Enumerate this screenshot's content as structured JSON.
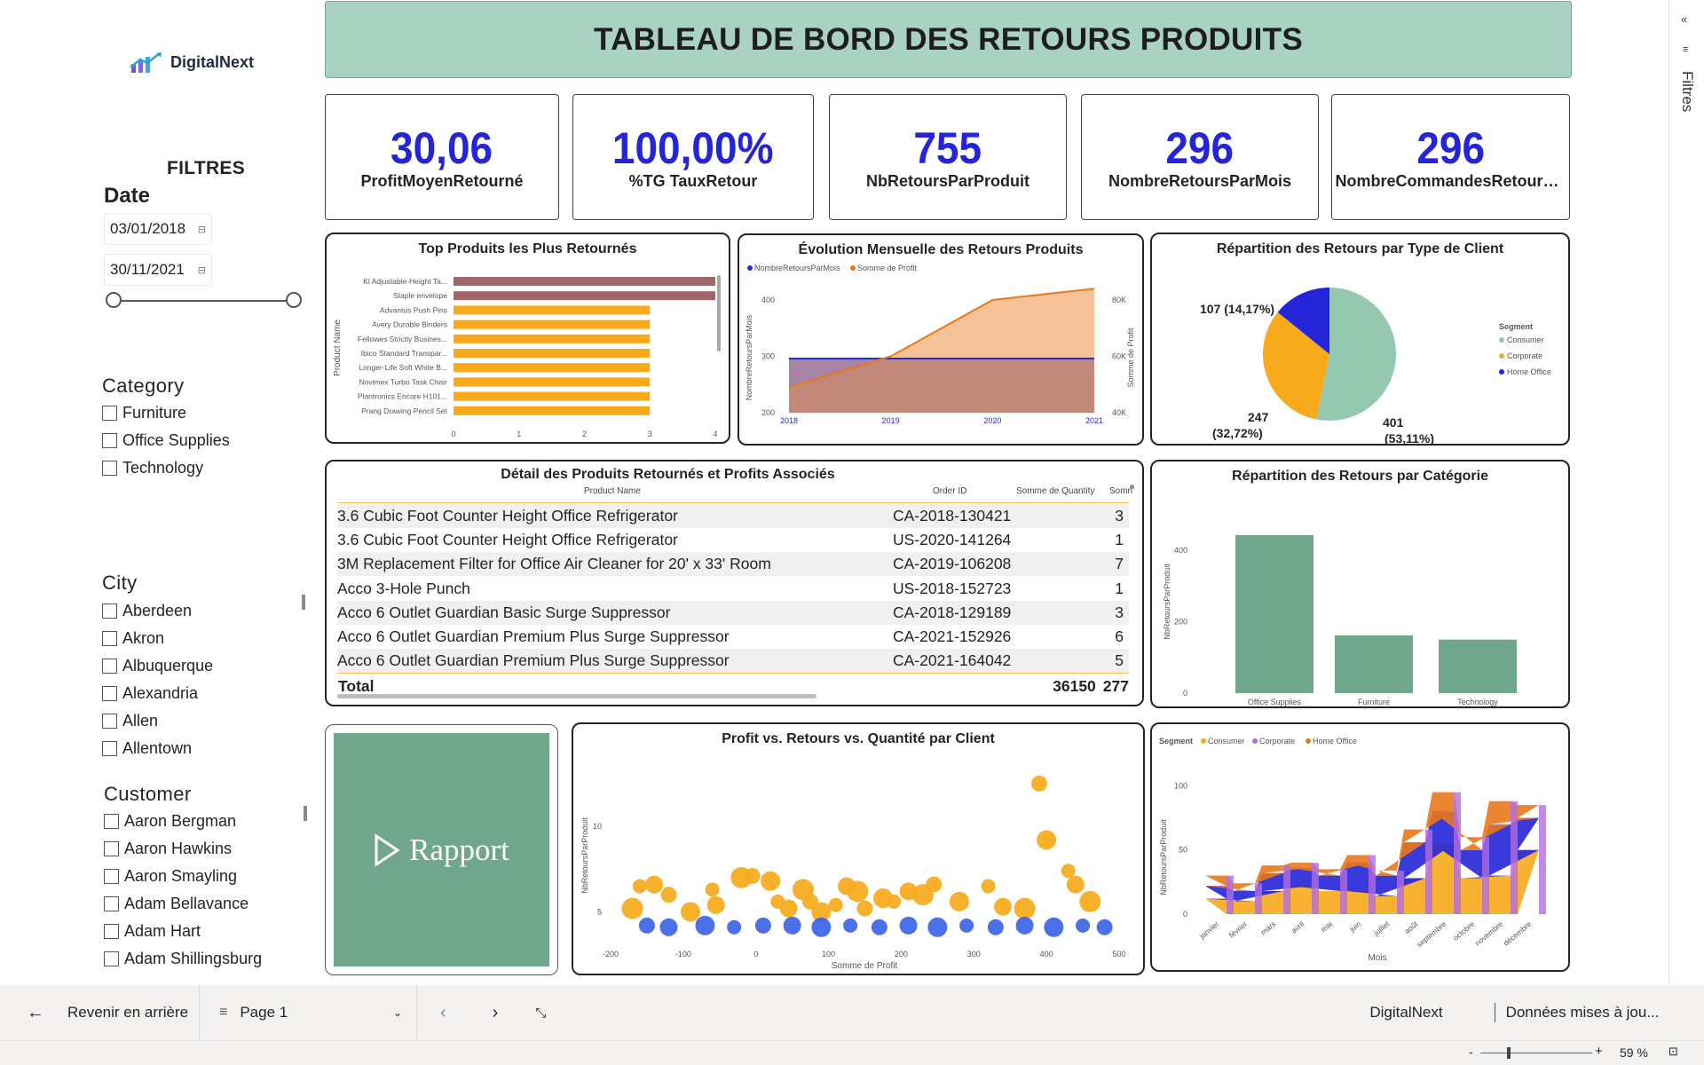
{
  "brand": {
    "name": "DigitalNext"
  },
  "sidebar": {
    "filters_title": "FILTRES",
    "date": {
      "title": "Date",
      "start": "03/01/2018",
      "end": "30/11/2021",
      "calendar_icon": "calendar-icon"
    },
    "category": {
      "title": "Category",
      "items": [
        "Furniture",
        "Office Supplies",
        "Technology"
      ]
    },
    "city": {
      "title": "City",
      "items": [
        "Aberdeen",
        "Akron",
        "Albuquerque",
        "Alexandria",
        "Allen",
        "Allentown"
      ]
    },
    "customer": {
      "title": "Customer",
      "items": [
        "Aaron Bergman",
        "Aaron Hawkins",
        "Aaron Smayling",
        "Adam Bellavance",
        "Adam Hart",
        "Adam Shillingsburg"
      ]
    }
  },
  "header": {
    "title": "TABLEAU DE BORD DES RETOURS PRODUITS"
  },
  "kpis": [
    {
      "value": "30,06",
      "label": "ProfitMoyenRetourné"
    },
    {
      "value": "100,00%",
      "label": "%TG TauxRetour"
    },
    {
      "value": "755",
      "label": "NbRetoursParProduit"
    },
    {
      "value": "296",
      "label": "NombreRetoursParMois"
    },
    {
      "value": "296",
      "label": "NombreCommandesRetourn..."
    }
  ],
  "top_products": {
    "title": "Top Produits les Plus Retournés",
    "ylabel": "Product Name",
    "x_ticks": [
      "0",
      "1",
      "2",
      "3",
      "4"
    ],
    "colors": {
      "top": "#a0666a",
      "rest": "#f7aa1b"
    }
  },
  "monthly": {
    "title": "Évolution Mensuelle des Retours Produits",
    "legend": [
      "NombreRetoursParMois",
      "Somme de Profit"
    ],
    "ylabel_left": "NombreRetoursParMois",
    "ylabel_right": "Somme de Profit",
    "left_ticks": [
      "400",
      "300",
      "200"
    ],
    "right_ticks": [
      "80K",
      "60K",
      "40K"
    ],
    "x_ticks": [
      "2018",
      "2019",
      "2020",
      "2021"
    ],
    "colors": {
      "returns": "#2b2bd6",
      "profit": "#e9781b"
    }
  },
  "segment_pie": {
    "title": "Répartition des Retours par Type de Client",
    "legend_title": "Segment",
    "labels": {
      "office": "107 (14,17%)",
      "corporate_count": "247",
      "corporate_pct": "(32,72%)",
      "consumer_count": "401",
      "consumer_pct": "(53,11%)"
    },
    "colors": {
      "consumer": "#95c7b1",
      "corporate": "#f7aa1b",
      "office": "#2424d8"
    }
  },
  "detail_table": {
    "title": "Détail des Produits Retournés et Profits Associés",
    "columns": [
      "Product Name",
      "Order ID",
      "Somme de Quantity",
      "Somn"
    ],
    "rows": [
      {
        "product": "3.6 Cubic Foot Counter Height Office Refrigerator",
        "order": "CA-2018-130421",
        "qty": "3"
      },
      {
        "product": "3.6 Cubic Foot Counter Height Office Refrigerator",
        "order": "US-2020-141264",
        "qty": "1"
      },
      {
        "product": "3M Replacement Filter for Office Air Cleaner for 20' x 33' Room",
        "order": "CA-2019-106208",
        "qty": "7"
      },
      {
        "product": "Acco 3-Hole Punch",
        "order": "US-2018-152723",
        "qty": "1"
      },
      {
        "product": "Acco 6 Outlet Guardian Basic Surge Suppressor",
        "order": "CA-2018-129189",
        "qty": "3"
      },
      {
        "product": "Acco 6 Outlet Guardian Premium Plus Surge Suppressor",
        "order": "CA-2021-152926",
        "qty": "6"
      },
      {
        "product": "Acco 6 Outlet Guardian Premium Plus Surge Suppressor",
        "order": "CA-2021-164042",
        "qty": "5"
      }
    ],
    "total_label": "Total",
    "total_qty": "36150",
    "total_extra": "277"
  },
  "category_chart": {
    "title": "Répartition des Retours par Catégorie",
    "xlabel": "Category",
    "ylabel": "NbRetoursParProduit",
    "y_ticks": [
      "400",
      "200",
      "0"
    ],
    "color": "#6fa68c"
  },
  "report_button": {
    "label": "Rapport",
    "color": "#6fa68c"
  },
  "scatter": {
    "title": "Profit vs. Retours vs. Quantité par Client",
    "xlabel": "Somme de Profit",
    "ylabel": "NbRetoursParProduit",
    "x_ticks": [
      "-200",
      "-100",
      "0",
      "100",
      "200",
      "300",
      "400",
      "500"
    ],
    "y_ticks": [
      "10",
      "5"
    ],
    "colors": {
      "high": "#f7aa1b",
      "low": "#3c64e6"
    }
  },
  "ribbon": {
    "legend_title": "Segment",
    "legend": [
      "Consumer",
      "Corporate",
      "Home Office"
    ],
    "xlabel": "Mois",
    "ylabel": "NbRetoursParProduit",
    "y_ticks": [
      "100",
      "50",
      "0"
    ],
    "months": [
      "janvier",
      "février",
      "mars",
      "avril",
      "mai",
      "juin",
      "juillet",
      "août",
      "septembre",
      "octobre",
      "novembre",
      "décembre"
    ],
    "colors": {
      "consumer": "#f7aa1b",
      "corporate": "#b36be0",
      "office": "#e9781b"
    }
  },
  "bottom_bar": {
    "back": "Revenir en arrière",
    "page": "Page 1",
    "brand": "DigitalNext",
    "updated": "Données mises à jou..."
  },
  "status_bar": {
    "zoom": "59 %"
  },
  "right_rail": {
    "label": "Filtres"
  },
  "chart_data": [
    {
      "type": "bar",
      "title": "Top Produits les Plus Retournés",
      "orientation": "horizontal",
      "categories": [
        "Kl Adjustable-Height Ta...",
        "Staple envelope",
        "Advantus Push Pins",
        "Avery Durable Binders",
        "Fellowes Strictly Busines...",
        "Ibico Standard Transpar...",
        "Longer-Life Soft White B...",
        "Novimex Turbo Task Chair",
        "Plantronics Encore H101...",
        "Prang Drawing Pencil Set"
      ],
      "values": [
        4,
        4,
        3,
        3,
        3,
        3,
        3,
        3,
        3,
        3
      ],
      "ylabel": "Product Name",
      "xlim": [
        0,
        4
      ]
    },
    {
      "type": "area",
      "title": "Évolution Mensuelle des Retours Produits",
      "x": [
        "2018",
        "2019",
        "2020",
        "2021"
      ],
      "series": [
        {
          "name": "NombreRetoursParMois",
          "values": [
            296,
            296,
            296,
            296
          ],
          "axis": "left"
        },
        {
          "name": "Somme de Profit",
          "values": [
            49000,
            60000,
            80000,
            84000
          ],
          "axis": "right"
        }
      ],
      "ylim_left": [
        200,
        400
      ],
      "ylim_right": [
        40000,
        80000
      ]
    },
    {
      "type": "pie",
      "title": "Répartition des Retours par Type de Client",
      "categories": [
        "Consumer",
        "Corporate",
        "Home Office"
      ],
      "values": [
        401,
        247,
        107
      ],
      "percent": [
        53.11,
        32.72,
        14.17
      ]
    },
    {
      "type": "bar",
      "title": "Répartition des Retours par Catégorie",
      "categories": [
        "Office Supplies",
        "Furniture",
        "Technology"
      ],
      "values": [
        443,
        162,
        150
      ],
      "xlabel": "Category",
      "ylabel": "NbRetoursParProduit",
      "ylim": [
        0,
        480
      ]
    },
    {
      "type": "scatter",
      "title": "Profit vs. Retours vs. Quantité par Client",
      "xlabel": "Somme de Profit",
      "ylabel": "NbRetoursParProduit",
      "xlim": [
        -200,
        500
      ],
      "ylim": [
        3,
        14
      ],
      "points": [
        [
          -160,
          6.5
        ],
        [
          -140,
          6.6
        ],
        [
          -170,
          5.2
        ],
        [
          -120,
          6
        ],
        [
          -90,
          5
        ],
        [
          -60,
          6.3
        ],
        [
          -55,
          5.4
        ],
        [
          -20,
          7
        ],
        [
          -5,
          7.1
        ],
        [
          20,
          6.8
        ],
        [
          30,
          5.6
        ],
        [
          45,
          5.2
        ],
        [
          65,
          6.3
        ],
        [
          75,
          5.6
        ],
        [
          90,
          5
        ],
        [
          110,
          5.4
        ],
        [
          125,
          6.5
        ],
        [
          140,
          6.2
        ],
        [
          150,
          5.2
        ],
        [
          175,
          5.8
        ],
        [
          190,
          5.6
        ],
        [
          210,
          6.2
        ],
        [
          230,
          6
        ],
        [
          245,
          6.6
        ],
        [
          280,
          5.6
        ],
        [
          320,
          6.5
        ],
        [
          340,
          5.3
        ],
        [
          370,
          5.2
        ],
        [
          390,
          12.5
        ],
        [
          400,
          9.2
        ],
        [
          430,
          7.4
        ],
        [
          440,
          6.6
        ],
        [
          460,
          5.6
        ],
        [
          -150,
          4.2
        ],
        [
          -120,
          4.1
        ],
        [
          -70,
          4.2
        ],
        [
          -30,
          4.1
        ],
        [
          10,
          4.2
        ],
        [
          50,
          4.2
        ],
        [
          90,
          4.1
        ],
        [
          130,
          4.2
        ],
        [
          170,
          4.1
        ],
        [
          210,
          4.2
        ],
        [
          250,
          4.1
        ],
        [
          290,
          4.2
        ],
        [
          330,
          4.1
        ],
        [
          370,
          4.2
        ],
        [
          410,
          4.1
        ],
        [
          450,
          4.2
        ],
        [
          480,
          4.1
        ]
      ]
    },
    {
      "type": "area",
      "title": "",
      "xlabel": "Mois",
      "ylabel": "NbRetoursParProduit",
      "ylim": [
        0,
        110
      ],
      "x": [
        "janvier",
        "février",
        "mars",
        "avril",
        "mai",
        "juin",
        "juillet",
        "août",
        "septembre",
        "octobre",
        "novembre",
        "décembre"
      ],
      "series": [
        {
          "name": "Consumer",
          "values": [
            12,
            10,
            18,
            22,
            18,
            18,
            14,
            28,
            55,
            28,
            30,
            50
          ]
        },
        {
          "name": "Corporate",
          "values": [
            10,
            8,
            14,
            14,
            12,
            22,
            16,
            28,
            25,
            22,
            40,
            25
          ]
        },
        {
          "name": "Home Office",
          "values": [
            8,
            6,
            6,
            4,
            5,
            6,
            4,
            10,
            15,
            10,
            18,
            10
          ]
        }
      ]
    }
  ]
}
